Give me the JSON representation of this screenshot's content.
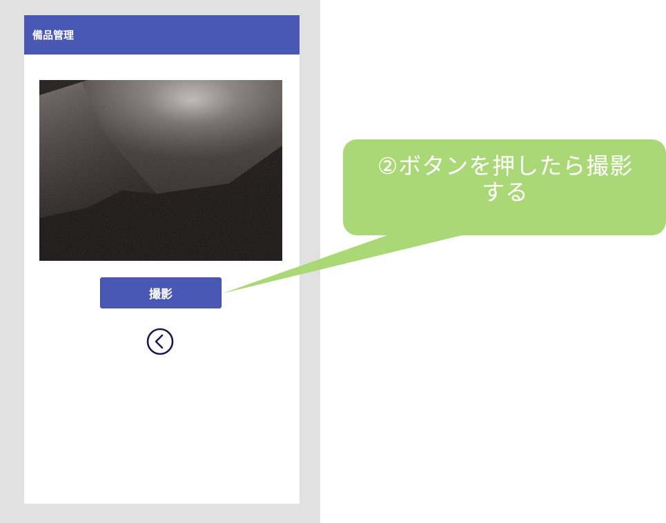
{
  "app": {
    "title": "備品管理"
  },
  "camera": {
    "capture_label": "撮影"
  },
  "navigation": {
    "back_icon": "chevron-left-circle-icon"
  },
  "callout": {
    "line1": "②ボタンを押したら撮影",
    "line2": "する"
  },
  "colors": {
    "header": "#4a58b5",
    "button": "#4a58b5",
    "callout": "#abd877",
    "frame": "#e1e1e1",
    "back_icon": "#1f1650"
  }
}
